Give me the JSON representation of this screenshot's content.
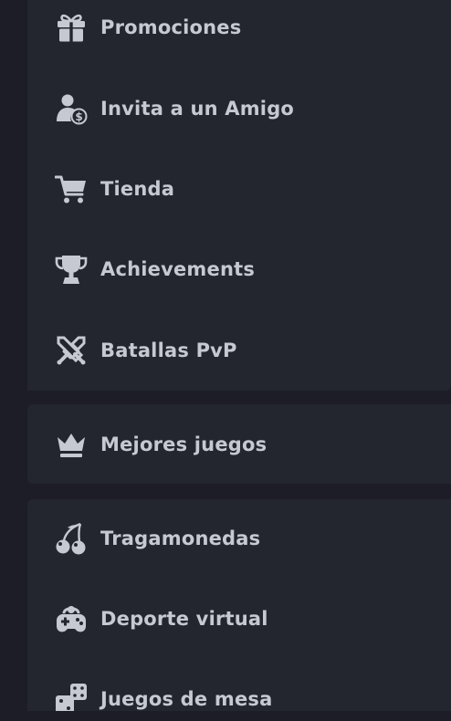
{
  "colors": {
    "background": "#1c1d27",
    "panel": "#23252f",
    "text": "#c6c8d2",
    "icon": "#c6c8d2"
  },
  "menu": {
    "group1": [
      {
        "label": "Promociones",
        "icon": "gift-icon"
      },
      {
        "label": "Invita a un Amigo",
        "icon": "refer-friend-icon"
      },
      {
        "label": "Tienda",
        "icon": "cart-icon"
      },
      {
        "label": "Achievements",
        "icon": "trophy-icon"
      },
      {
        "label": "Batallas PvP",
        "icon": "crossed-swords-icon"
      }
    ],
    "group2": [
      {
        "label": "Mejores juegos",
        "icon": "crown-icon"
      }
    ],
    "group3": [
      {
        "label": "Tragamonedas",
        "icon": "cherries-icon"
      },
      {
        "label": "Deporte virtual",
        "icon": "gamepad-icon"
      },
      {
        "label": "Juegos de mesa",
        "icon": "dice-icon"
      }
    ]
  }
}
